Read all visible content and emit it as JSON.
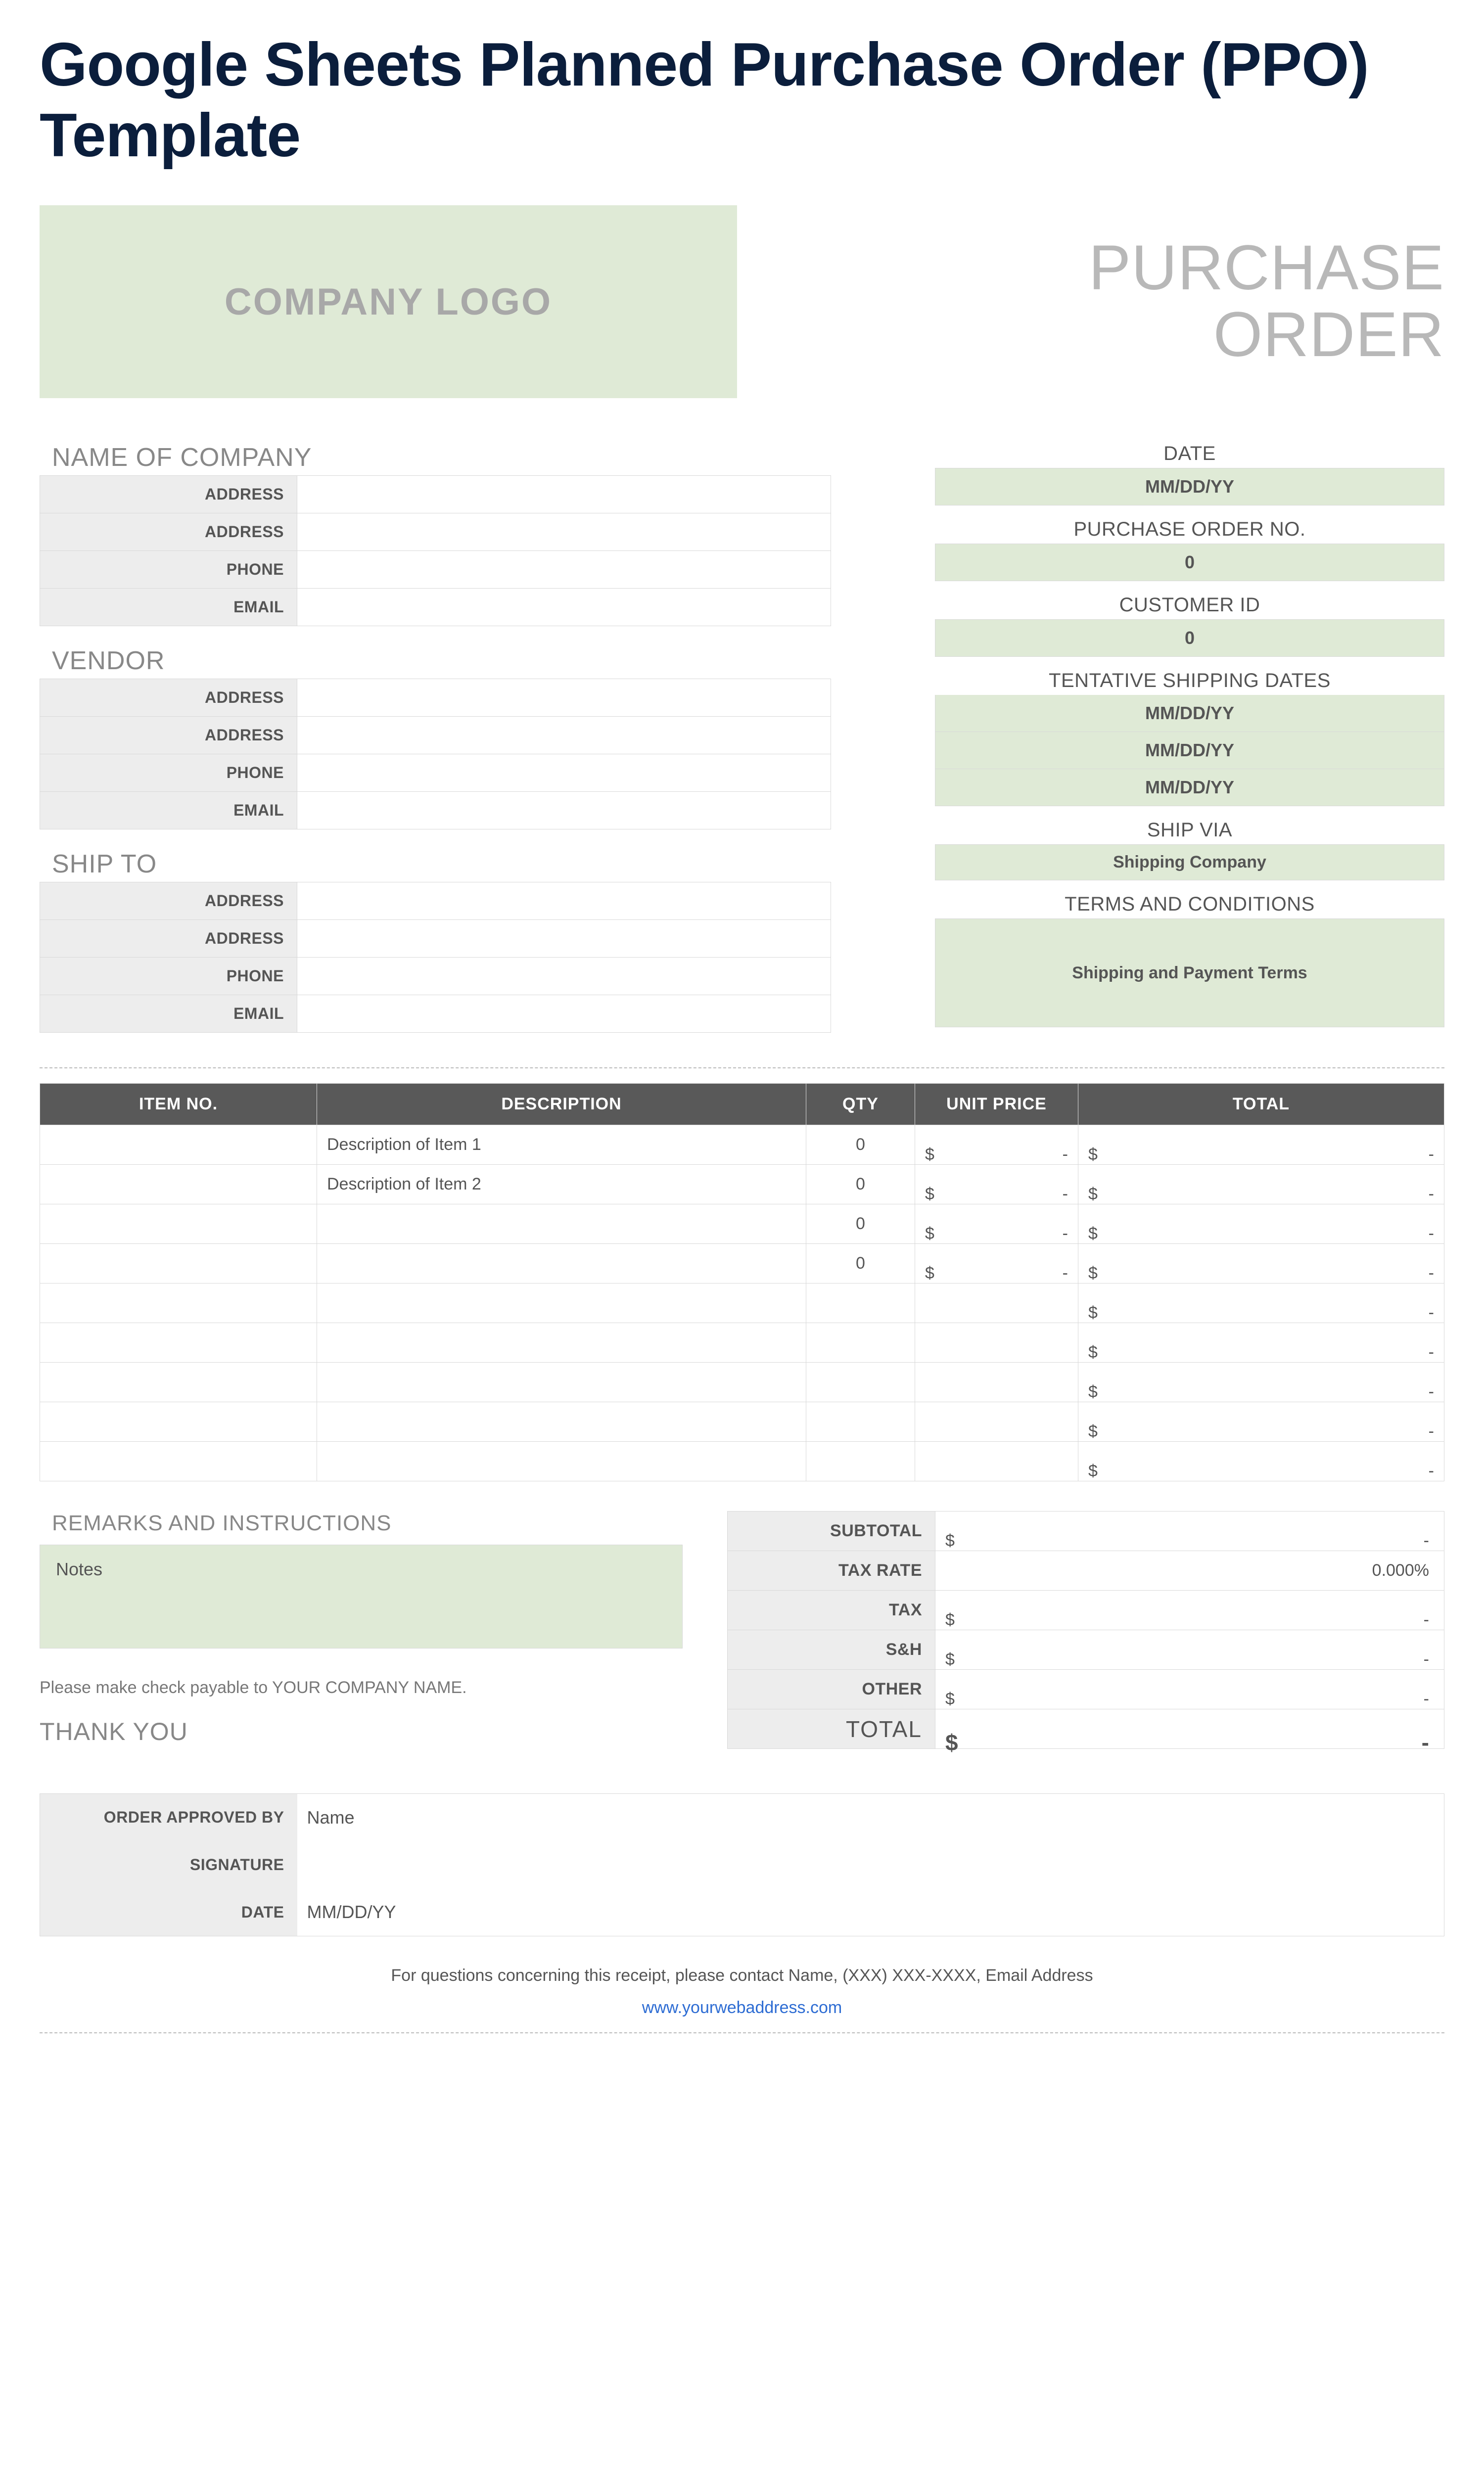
{
  "page_title": "Google Sheets Planned Purchase Order (PPO) Template",
  "logo_text": "COMPANY LOGO",
  "po_title_line1": "PURCHASE",
  "po_title_line2": "ORDER",
  "company": {
    "heading": "NAME OF COMPANY",
    "labels": {
      "address1": "ADDRESS",
      "address2": "ADDRESS",
      "phone": "PHONE",
      "email": "EMAIL"
    },
    "values": {
      "address1": "",
      "address2": "",
      "phone": "",
      "email": ""
    }
  },
  "vendor": {
    "heading": "VENDOR",
    "labels": {
      "address1": "ADDRESS",
      "address2": "ADDRESS",
      "phone": "PHONE",
      "email": "EMAIL"
    },
    "values": {
      "address1": "",
      "address2": "",
      "phone": "",
      "email": ""
    }
  },
  "ship_to": {
    "heading": "SHIP TO",
    "labels": {
      "address1": "ADDRESS",
      "address2": "ADDRESS",
      "phone": "PHONE",
      "email": "EMAIL"
    },
    "values": {
      "address1": "",
      "address2": "",
      "phone": "",
      "email": ""
    }
  },
  "right": {
    "date_label": "DATE",
    "date_value": "MM/DD/YY",
    "po_no_label": "PURCHASE ORDER NO.",
    "po_no_value": "0",
    "customer_id_label": "CUSTOMER ID",
    "customer_id_value": "0",
    "ship_dates_label": "TENTATIVE SHIPPING DATES",
    "ship_dates": [
      "MM/DD/YY",
      "MM/DD/YY",
      "MM/DD/YY"
    ],
    "ship_via_label": "SHIP VIA",
    "ship_via_value": "Shipping Company",
    "terms_label": "TERMS AND CONDITIONS",
    "terms_value": "Shipping and Payment Terms"
  },
  "items": {
    "headers": {
      "item_no": "ITEM NO.",
      "description": "DESCRIPTION",
      "qty": "QTY",
      "unit_price": "UNIT PRICE",
      "total": "TOTAL"
    },
    "rows": [
      {
        "item_no": "",
        "description": "Description of Item 1",
        "qty": "0",
        "unit_price_sym": "$",
        "unit_price_dash": "-",
        "total_sym": "$",
        "total_dash": "-"
      },
      {
        "item_no": "",
        "description": "Description of Item 2",
        "qty": "0",
        "unit_price_sym": "$",
        "unit_price_dash": "-",
        "total_sym": "$",
        "total_dash": "-"
      },
      {
        "item_no": "",
        "description": "",
        "qty": "0",
        "unit_price_sym": "$",
        "unit_price_dash": "-",
        "total_sym": "$",
        "total_dash": "-"
      },
      {
        "item_no": "",
        "description": "",
        "qty": "0",
        "unit_price_sym": "$",
        "unit_price_dash": "-",
        "total_sym": "$",
        "total_dash": "-"
      },
      {
        "item_no": "",
        "description": "",
        "qty": "",
        "unit_price_sym": "",
        "unit_price_dash": "",
        "total_sym": "$",
        "total_dash": "-"
      },
      {
        "item_no": "",
        "description": "",
        "qty": "",
        "unit_price_sym": "",
        "unit_price_dash": "",
        "total_sym": "$",
        "total_dash": "-"
      },
      {
        "item_no": "",
        "description": "",
        "qty": "",
        "unit_price_sym": "",
        "unit_price_dash": "",
        "total_sym": "$",
        "total_dash": "-"
      },
      {
        "item_no": "",
        "description": "",
        "qty": "",
        "unit_price_sym": "",
        "unit_price_dash": "",
        "total_sym": "$",
        "total_dash": "-"
      },
      {
        "item_no": "",
        "description": "",
        "qty": "",
        "unit_price_sym": "",
        "unit_price_dash": "",
        "total_sym": "$",
        "total_dash": "-"
      }
    ]
  },
  "remarks": {
    "heading": "REMARKS AND INSTRUCTIONS",
    "notes": "Notes",
    "payable": "Please make check payable to YOUR COMPANY NAME.",
    "thank_you": "THANK YOU"
  },
  "totals": {
    "subtotal_label": "SUBTOTAL",
    "subtotal_sym": "$",
    "subtotal_dash": "-",
    "tax_rate_label": "TAX RATE",
    "tax_rate_value": "0.000%",
    "tax_label": "TAX",
    "tax_sym": "$",
    "tax_dash": "-",
    "sh_label": "S&H",
    "sh_sym": "$",
    "sh_dash": "-",
    "other_label": "OTHER",
    "other_sym": "$",
    "other_dash": "-",
    "total_label": "TOTAL",
    "total_sym": "$",
    "total_dash": "-"
  },
  "approval": {
    "labels": {
      "approved_by": "ORDER APPROVED BY",
      "signature": "SIGNATURE",
      "date": "DATE"
    },
    "values": {
      "approved_by": "Name",
      "signature": "",
      "date": "MM/DD/YY"
    }
  },
  "footer": {
    "text": "For questions concerning this receipt, please contact Name, (XXX) XXX-XXXX, Email Address",
    "link": "www.yourwebaddress.com"
  }
}
